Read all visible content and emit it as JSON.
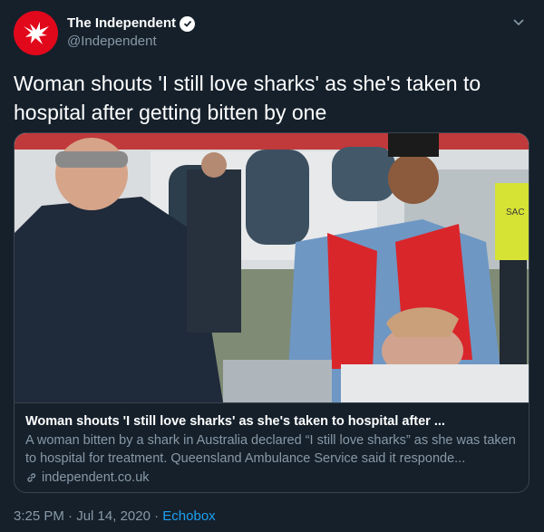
{
  "account": {
    "display_name": "The Independent",
    "handle": "@Independent",
    "avatar_icon": "eagle-logo-icon",
    "verified_icon": "verified-badge-icon"
  },
  "tweet": {
    "text": "Woman shouts 'I still love sharks' as she's taken to hospital after getting bitten by one"
  },
  "card": {
    "title": "Woman shouts 'I still love sharks' as she's taken to hospital after ...",
    "description": "A woman bitten by a shark in Australia declared “I still love sharks” as she was taken to hospital for treatment. Queensland Ambulance Service said it responde...",
    "domain": "independent.co.uk",
    "link_icon": "link-icon",
    "media_text": "SAC"
  },
  "meta": {
    "time": "3:25 PM",
    "separator": "·",
    "date": "Jul 14, 2020",
    "separator2": "·",
    "source": "Echobox"
  },
  "colors": {
    "background": "#15202b",
    "secondary_text": "#8899a6",
    "link": "#1da1f2",
    "brand_red": "#e2081b"
  }
}
